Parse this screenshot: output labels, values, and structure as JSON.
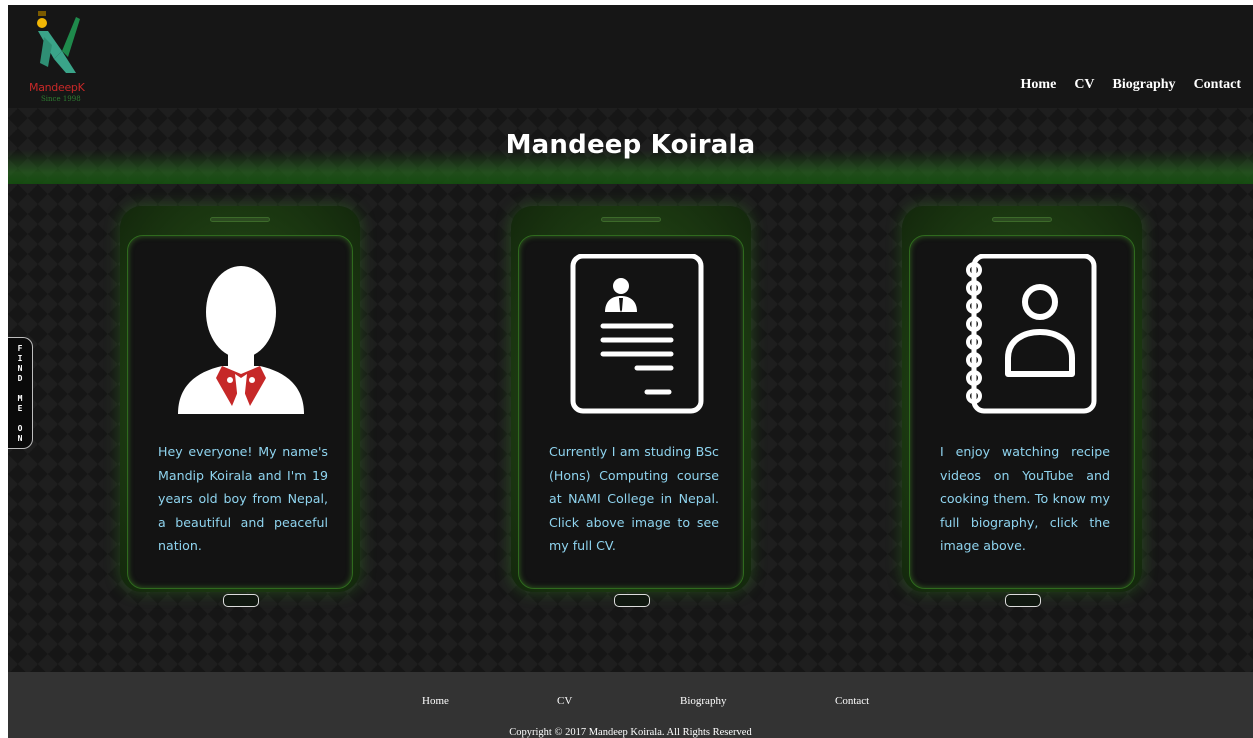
{
  "brand": {
    "name": "MandeepK",
    "since": "Since 1998"
  },
  "nav": {
    "items": [
      {
        "label": "Home"
      },
      {
        "label": "CV"
      },
      {
        "label": "Biography"
      },
      {
        "label": "Contact"
      }
    ]
  },
  "hero": {
    "title": "Mandeep Koirala"
  },
  "side_tab": {
    "label": "F\nI\nN\nD\n \nM\nE\n \nO\nN"
  },
  "cards": [
    {
      "icon": "user-avatar-icon",
      "text": "Hey everyone! My name's Mandip Koirala and I'm 19 years old boy from Nepal, a beautiful and peaceful nation."
    },
    {
      "icon": "resume-document-icon",
      "text": "Currently I am studing BSc (Hons) Computing course at NAMI College in Nepal. Click above image to see my full CV."
    },
    {
      "icon": "address-book-icon",
      "text": "I enjoy watching recipe videos on YouTube and cooking them. To know my full biography, click the image above."
    }
  ],
  "footer": {
    "links": [
      {
        "label": "Home"
      },
      {
        "label": "CV"
      },
      {
        "label": "Biography"
      },
      {
        "label": "Contact"
      }
    ],
    "copyright": "Copyright © 2017 Mandeep Koirala. All Rights Reserved"
  },
  "colors": {
    "background": "#161616",
    "accent_green": "#2f6a1e",
    "description_text": "#8fd4ef",
    "footer_bg": "#333333"
  }
}
